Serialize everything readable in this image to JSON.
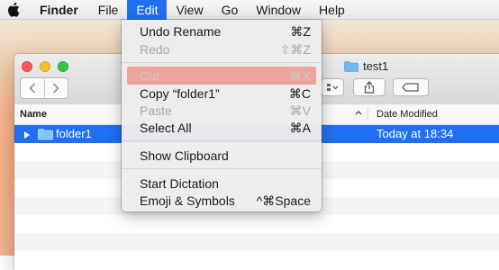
{
  "menubar": {
    "app_name": "Finder",
    "items": [
      "File",
      "Edit",
      "View",
      "Go",
      "Window",
      "Help"
    ],
    "active_item": "Edit"
  },
  "window": {
    "title": "test1",
    "columns": {
      "name": "Name",
      "date_modified": "Date Modified"
    },
    "rows": [
      {
        "name": "folder1",
        "date": "Today at 18:34",
        "selected": true
      }
    ]
  },
  "edit_menu": {
    "undo": {
      "label": "Undo Rename",
      "shortcut": "⌘Z"
    },
    "redo": {
      "label": "Redo",
      "shortcut": "⇧⌘Z"
    },
    "cut": {
      "label": "Cut",
      "shortcut": "⌘X"
    },
    "copy": {
      "label": "Copy “folder1”",
      "shortcut": "⌘C"
    },
    "paste": {
      "label": "Paste",
      "shortcut": "⌘V"
    },
    "select_all": {
      "label": "Select All",
      "shortcut": "⌘A"
    },
    "show_clipboard": {
      "label": "Show Clipboard"
    },
    "start_dictation": {
      "label": "Start Dictation"
    },
    "emoji": {
      "label": "Emoji & Symbols",
      "shortcut": "^⌘Space"
    }
  },
  "colors": {
    "selection": "#1f6ff0",
    "menu_highlight": "#eda49b",
    "folder": "#5fb4ef"
  }
}
